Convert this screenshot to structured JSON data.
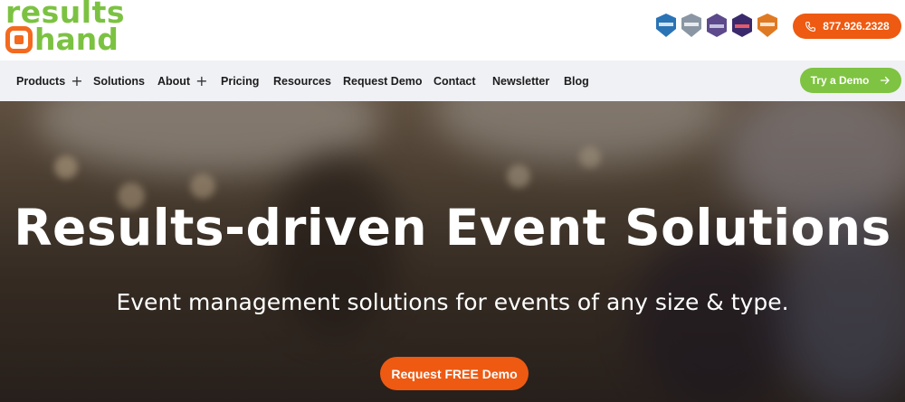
{
  "brand": {
    "logo_line1": "results",
    "logo_line2": "hand",
    "colors": {
      "green": "#7cc242",
      "orange": "#ee5a12",
      "nav_bg": "#f0f1f5"
    }
  },
  "badges": [
    {
      "icon": "capterra-badge-icon",
      "color": "#2a74b5"
    },
    {
      "icon": "capterra-badge-icon",
      "color": "#8a96a3"
    },
    {
      "icon": "g2-badge-icon",
      "color": "#5c4a8c"
    },
    {
      "icon": "g2-badge-icon",
      "color": "#3b2a6b"
    },
    {
      "icon": "capterra-badge-icon",
      "color": "#e07a22"
    }
  ],
  "header": {
    "phone": "877.926.2328",
    "phone_icon": "phone-icon"
  },
  "nav": {
    "items": [
      {
        "label": "Products",
        "has_submenu": true
      },
      {
        "label": "Solutions",
        "has_submenu": false
      },
      {
        "label": "About",
        "has_submenu": true
      },
      {
        "label": "Pricing",
        "has_submenu": false
      },
      {
        "label": "Resources",
        "has_submenu": false
      },
      {
        "label": "Request Demo",
        "has_submenu": false
      },
      {
        "label": "Contact",
        "has_submenu": false
      },
      {
        "label": "Newsletter",
        "has_submenu": false
      },
      {
        "label": "Blog",
        "has_submenu": false
      }
    ],
    "submenu_glyph": "+",
    "cta_label": "Try a Demo",
    "cta_icon": "arrow-right-icon"
  },
  "hero": {
    "title": "Results-driven Event Solutions",
    "subtitle": "Event management solutions for events of any size & type.",
    "cta_label": "Request FREE Demo"
  }
}
